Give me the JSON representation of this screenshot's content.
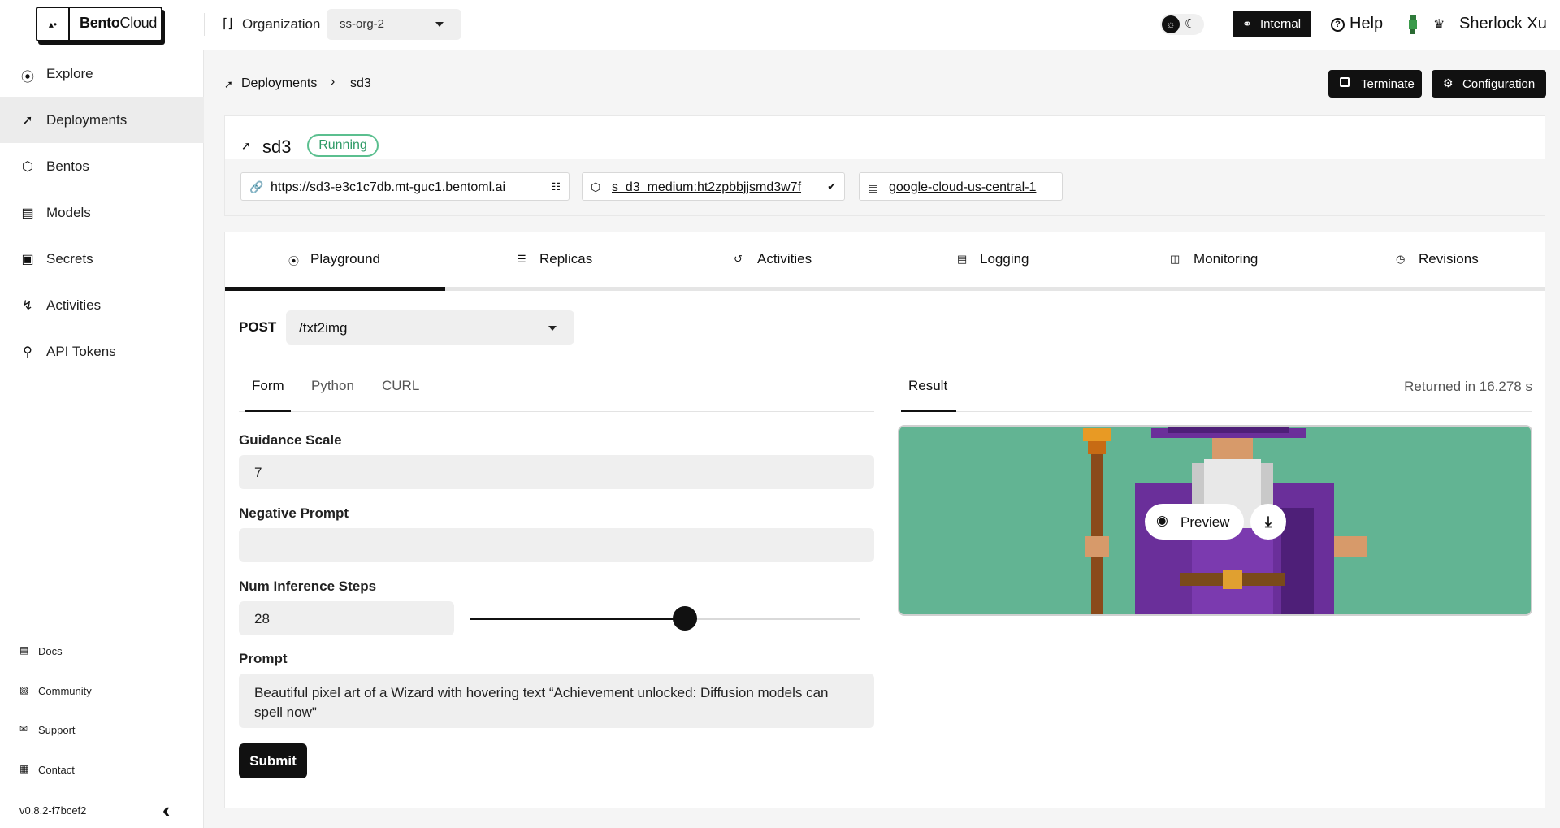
{
  "topbar": {
    "brand_bold": "Bento",
    "brand_rest": "Cloud",
    "org_label": "Organization",
    "org_value": "ss-org-2",
    "internal_label": "Internal",
    "help_label": "Help",
    "user_name": "Sherlock Xu"
  },
  "sidebar": {
    "items": [
      {
        "label": "Explore",
        "icon": "compass-icon",
        "active": false
      },
      {
        "label": "Deployments",
        "icon": "rocket-icon",
        "active": true
      },
      {
        "label": "Bentos",
        "icon": "box-icon",
        "active": false
      },
      {
        "label": "Models",
        "icon": "file-icon",
        "active": false
      },
      {
        "label": "Secrets",
        "icon": "secret-icon",
        "active": false
      },
      {
        "label": "Activities",
        "icon": "activity-icon",
        "active": false
      },
      {
        "label": "API Tokens",
        "icon": "key-icon",
        "active": false
      }
    ],
    "footer": [
      {
        "label": "Docs",
        "icon": "doc-icon"
      },
      {
        "label": "Community",
        "icon": "community-icon"
      },
      {
        "label": "Support",
        "icon": "support-icon"
      },
      {
        "label": "Contact",
        "icon": "contact-icon"
      }
    ],
    "version": "v0.8.2-f7bcef2"
  },
  "breadcrumb": {
    "parent": "Deployments",
    "current": "sd3"
  },
  "actions": {
    "terminate": "Terminate",
    "configuration": "Configuration"
  },
  "deployment": {
    "name": "sd3",
    "status": "Running",
    "url": "https://sd3-e3c1c7db.mt-guc1.bentoml.ai",
    "bento": "s_d3_medium:ht2zpbbjjsmd3w7f",
    "cluster": "google-cloud-us-central-1"
  },
  "tabs": [
    {
      "label": "Playground",
      "icon": "broadcast-icon"
    },
    {
      "label": "Replicas",
      "icon": "layers-icon"
    },
    {
      "label": "Activities",
      "icon": "history-icon"
    },
    {
      "label": "Logging",
      "icon": "log-icon"
    },
    {
      "label": "Monitoring",
      "icon": "monitor-icon"
    },
    {
      "label": "Revisions",
      "icon": "revision-icon"
    }
  ],
  "playground": {
    "method": "POST",
    "endpoint": "/txt2img",
    "subtabs": [
      "Form",
      "Python",
      "CURL"
    ],
    "fields": {
      "guidance_scale_label": "Guidance Scale",
      "guidance_scale_value": "7",
      "negative_prompt_label": "Negative Prompt",
      "negative_prompt_value": "",
      "steps_label": "Num Inference Steps",
      "steps_value": "28",
      "steps_slider_fraction": 0.55,
      "prompt_label": "Prompt",
      "prompt_value": "Beautiful pixel art of a Wizard with hovering text “Achievement unlocked: Diffusion models can spell now\""
    },
    "submit": "Submit"
  },
  "result": {
    "tab": "Result",
    "returned": "Returned in 16.278 s",
    "preview": "Preview"
  },
  "colors": {
    "status_green": "#2e9a66",
    "image_bg": "#62b493",
    "primary": "#111111"
  }
}
